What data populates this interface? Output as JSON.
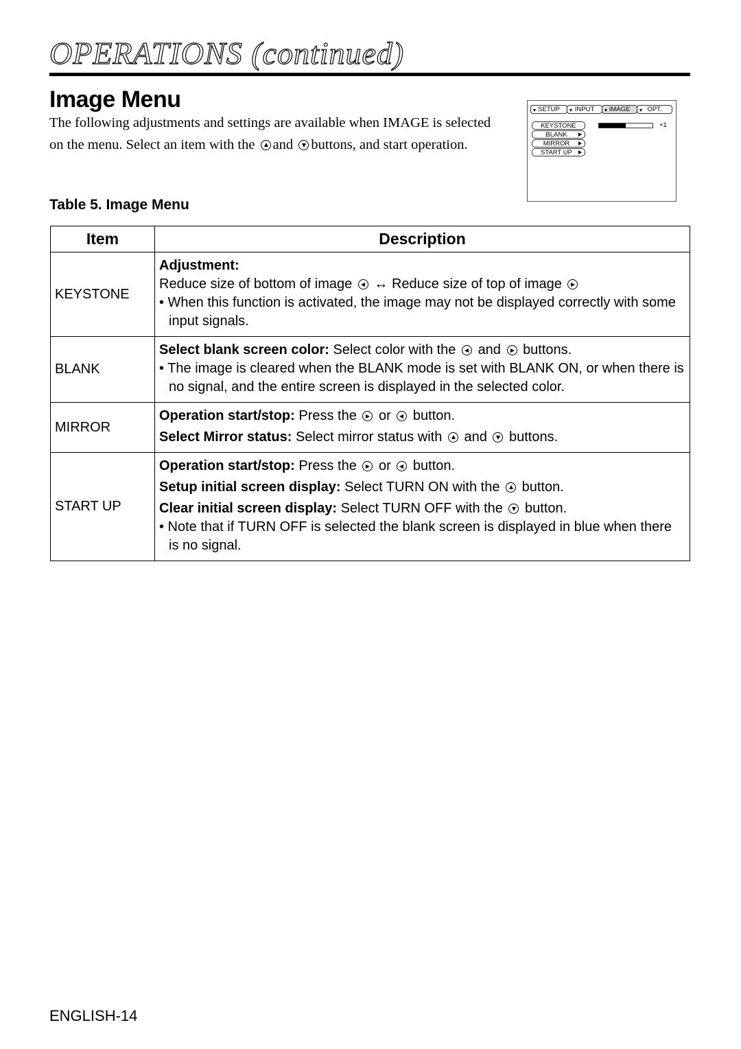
{
  "header": {
    "title": "OPERATIONS (continued)"
  },
  "section": {
    "title": "Image Menu",
    "intro": {
      "part1": "The following adjustments and settings are available when IMAGE is selected on the menu. Select an item with the",
      "icon1": "up-button-icon",
      "and": "and",
      "icon2": "down-button-icon",
      "part2": "buttons, and start operation."
    }
  },
  "osd_menu": {
    "tabs": [
      {
        "label": "SETUP",
        "active": false
      },
      {
        "label": "INPUT",
        "active": false
      },
      {
        "label": "IMAGE",
        "active": true
      },
      {
        "label": "OPT.",
        "active": false
      }
    ],
    "items": [
      {
        "label": "KEYSTONE",
        "has_arrow": false
      },
      {
        "label": "BLANK",
        "has_arrow": true
      },
      {
        "label": "MIRROR",
        "has_arrow": true
      },
      {
        "label": "START UP",
        "has_arrow": true
      }
    ],
    "keystone_bar_fraction": 0.5,
    "keystone_value": "+1"
  },
  "table": {
    "caption": "Table 5. Image Menu",
    "headers": {
      "item": "Item",
      "description": "Description"
    },
    "rows": [
      {
        "item": "KEYSTONE",
        "lines": {
          "l1_bold": "Adjustment:",
          "l2a": "Reduce size of bottom of image",
          "l2_arrow": "↔",
          "l2b": "Reduce size of top of image",
          "bullet": "• When this function is activated, the image may not be displayed correctly with some input signals."
        }
      },
      {
        "item": "BLANK",
        "lines": {
          "l1_bold": "Select blank screen color:",
          "l1a": "Select color with the",
          "l1_and": "and",
          "l1b": "buttons.",
          "bullet": "• The image is cleared when the BLANK mode is set with BLANK ON, or when there is no signal, and the entire screen is displayed in the selected color."
        }
      },
      {
        "item": "MIRROR",
        "lines": {
          "l1_bold": "Operation start/stop:",
          "l1a": "Press the",
          "l1_or": "or",
          "l1b": "button.",
          "l2_bold": "Select Mirror status:",
          "l2a": "Select mirror status with",
          "l2_and": "and",
          "l2b": "buttons."
        }
      },
      {
        "item": "START UP",
        "lines": {
          "l1_bold": "Operation start/stop:",
          "l1a": "Press the",
          "l1_or": "or",
          "l1b": "button.",
          "l2_bold": "Setup initial screen display:",
          "l2a": "Select TURN ON with the",
          "l2b": "button.",
          "l3_bold": "Clear initial screen display:",
          "l3a": "Select TURN OFF with the",
          "l3b": "button.",
          "bullet": "• Note that if TURN OFF is selected the blank screen is displayed in blue when there is no signal."
        }
      }
    ]
  },
  "footer": {
    "page_label": "ENGLISH-14"
  }
}
